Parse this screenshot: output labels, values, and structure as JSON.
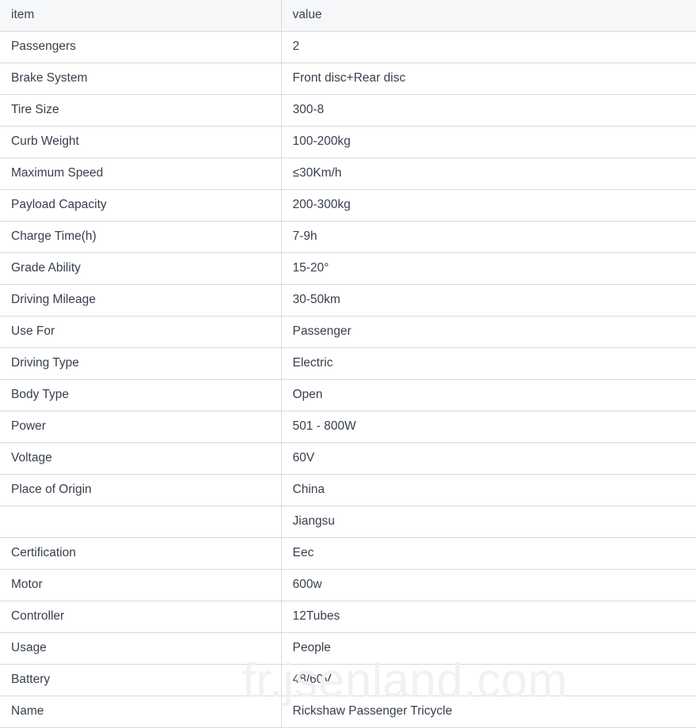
{
  "table": {
    "headers": {
      "item": "item",
      "value": "value"
    },
    "rows": [
      {
        "item": "Passengers",
        "value": "2"
      },
      {
        "item": "Brake System",
        "value": "Front disc+Rear disc"
      },
      {
        "item": "Tire Size",
        "value": "300-8"
      },
      {
        "item": "Curb Weight",
        "value": "100-200kg"
      },
      {
        "item": "Maximum Speed",
        "value": "≤30Km/h"
      },
      {
        "item": "Payload Capacity",
        "value": "200-300kg"
      },
      {
        "item": "Charge Time(h)",
        "value": "7-9h"
      },
      {
        "item": "Grade Ability",
        "value": "15-20°"
      },
      {
        "item": "Driving Mileage",
        "value": "30-50km"
      },
      {
        "item": "Use For",
        "value": "Passenger"
      },
      {
        "item": "Driving Type",
        "value": "Electric"
      },
      {
        "item": "Body Type",
        "value": "Open"
      },
      {
        "item": "Power",
        "value": "501 - 800W"
      },
      {
        "item": "Voltage",
        "value": "60V"
      },
      {
        "item": "Place of Origin",
        "value": "China"
      },
      {
        "item": "",
        "value": "Jiangsu"
      },
      {
        "item": "Certification",
        "value": "Eec"
      },
      {
        "item": "Motor",
        "value": "600w"
      },
      {
        "item": "Controller",
        "value": "12Tubes"
      },
      {
        "item": "Usage",
        "value": "People"
      },
      {
        "item": "Battery",
        "value": "48/60V"
      },
      {
        "item": "Name",
        "value": "Rickshaw Passenger Tricycle"
      }
    ]
  },
  "watermark": {
    "text": "fr.jsenland.com",
    "color": "#f1f1f1"
  },
  "colors": {
    "header_background": "#f6f7f9",
    "border": "#d9d9d9",
    "text": "#37404c",
    "page_background": "#ffffff"
  }
}
